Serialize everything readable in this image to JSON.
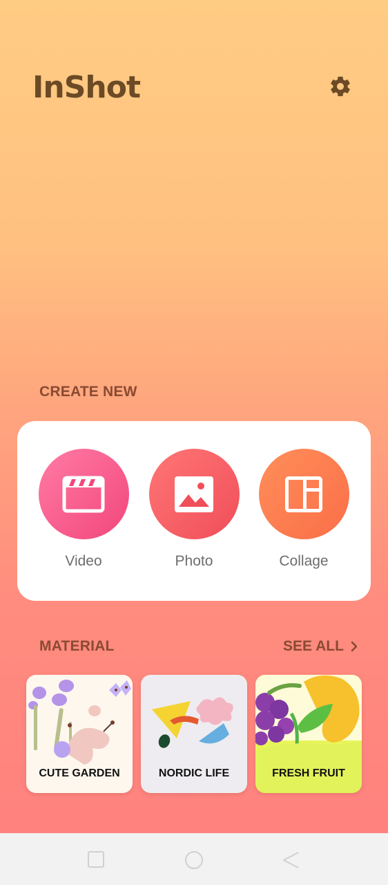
{
  "header": {
    "logo_text": "InShot",
    "settings_icon": "gear-icon"
  },
  "create_new": {
    "title": "CREATE NEW",
    "items": [
      {
        "label": "Video",
        "icon": "clapperboard-icon",
        "color": "#f2467c"
      },
      {
        "label": "Photo",
        "icon": "image-icon",
        "color": "#f04e59"
      },
      {
        "label": "Collage",
        "icon": "collage-layout-icon",
        "color": "#fb6e48"
      }
    ]
  },
  "material": {
    "title": "MATERIAL",
    "see_all_label": "SEE ALL",
    "see_all_icon": "chevron-right-icon",
    "items": [
      {
        "label": "CUTE GARDEN"
      },
      {
        "label": "NORDIC LIFE"
      },
      {
        "label": "FRESH FRUIT"
      }
    ]
  },
  "system_nav": {
    "buttons": [
      "recent-apps-icon",
      "home-icon",
      "back-icon"
    ]
  },
  "colors": {
    "brand_text": "#6b4a25",
    "section_title": "#8a4a32",
    "card_bg": "#ffffff"
  }
}
